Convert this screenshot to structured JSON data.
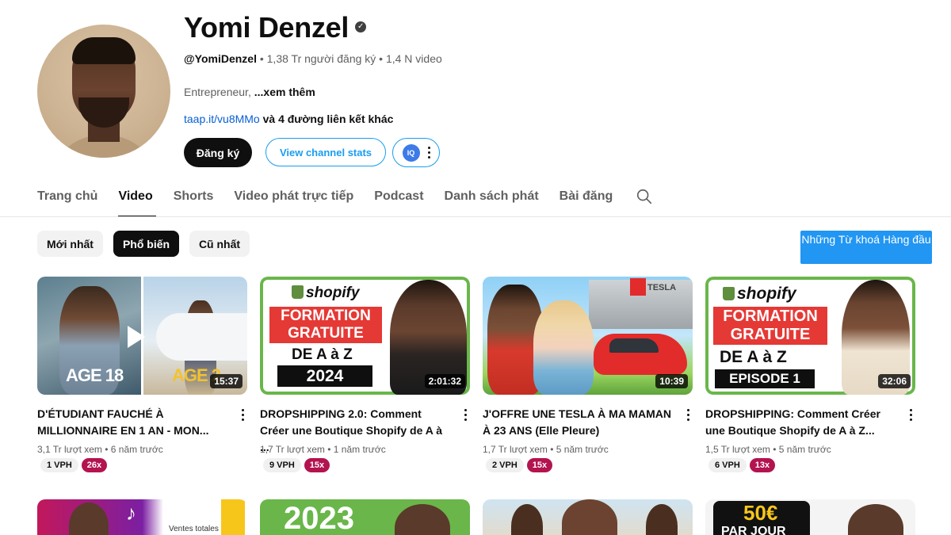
{
  "channel": {
    "name": "Yomi Denzel",
    "handle": "@YomiDenzel",
    "stats": " • 1,38 Tr người đăng ký • 1,4 N video",
    "description": "Entrepreneur, ",
    "more_label": "...xem thêm",
    "link": "taap.it/vu8MMo",
    "link_more": " và 4 đường liên kết khác",
    "subscribe_label": "Đăng ký",
    "stats_button_label": "View channel stats",
    "iq_label": "IQ"
  },
  "tabs": [
    "Trang chủ",
    "Video",
    "Shorts",
    "Video phát trực tiếp",
    "Podcast",
    "Danh sách phát",
    "Bài đăng"
  ],
  "active_tab": "Video",
  "chips": [
    "Mới nhất",
    "Phổ biến",
    "Cũ nhất"
  ],
  "active_chip": "Phổ biến",
  "keyword_button_label": "Những Từ khoá Hàng đầu",
  "videos": [
    {
      "title": "D'ÉTUDIANT FAUCHÉ À MILLIONNAIRE EN 1 AN - MON...",
      "stats": "3,1 Tr lượt xem • 6 năm trước",
      "duration": "15:37",
      "vph": "1 VPH",
      "multiplier": "26x",
      "thumb_text": [
        "AGE 18",
        "AGE 2"
      ]
    },
    {
      "title": "DROPSHIPPING 2.0: Comment Créer une Boutique Shopify de A à ...",
      "stats": "1,7 Tr lượt xem • 1 năm trước",
      "duration": "2:01:32",
      "vph": "9 VPH",
      "multiplier": "15x",
      "thumb_text": [
        "shopify",
        "FORMATION",
        "GRATUITE",
        "DE A à Z",
        "2024"
      ]
    },
    {
      "title": "J'OFFRE UNE TESLA À MA MAMAN À 23 ANS (Elle Pleure)",
      "stats": "1,7 Tr lượt xem • 5 năm trước",
      "duration": "10:39",
      "vph": "2 VPH",
      "multiplier": "15x",
      "thumb_text": [
        "TESLA"
      ]
    },
    {
      "title": "DROPSHIPPING: Comment Créer une Boutique Shopify de A à Z...",
      "stats": "1,5 Tr lượt xem • 5 năm trước",
      "duration": "32:06",
      "vph": "6 VPH",
      "multiplier": "13x",
      "thumb_text": [
        "shopify",
        "FORMATION",
        "GRATUITE",
        "DE A à Z",
        "EPISODE 1"
      ]
    }
  ],
  "row2_thumb_text": [
    "Ventes totales",
    "2023",
    "50€",
    "PAR JOUR"
  ],
  "colors": {
    "accent_blue": "#065fd4",
    "stats_button": "#1a9df0",
    "keyword_button": "#2196f3",
    "multiplier_badge": "#b3134f",
    "shopify_green": "#6ab64a"
  },
  "icons": [
    "verified-icon",
    "search-icon",
    "more-vert-icon",
    "iq-logo-icon"
  ]
}
